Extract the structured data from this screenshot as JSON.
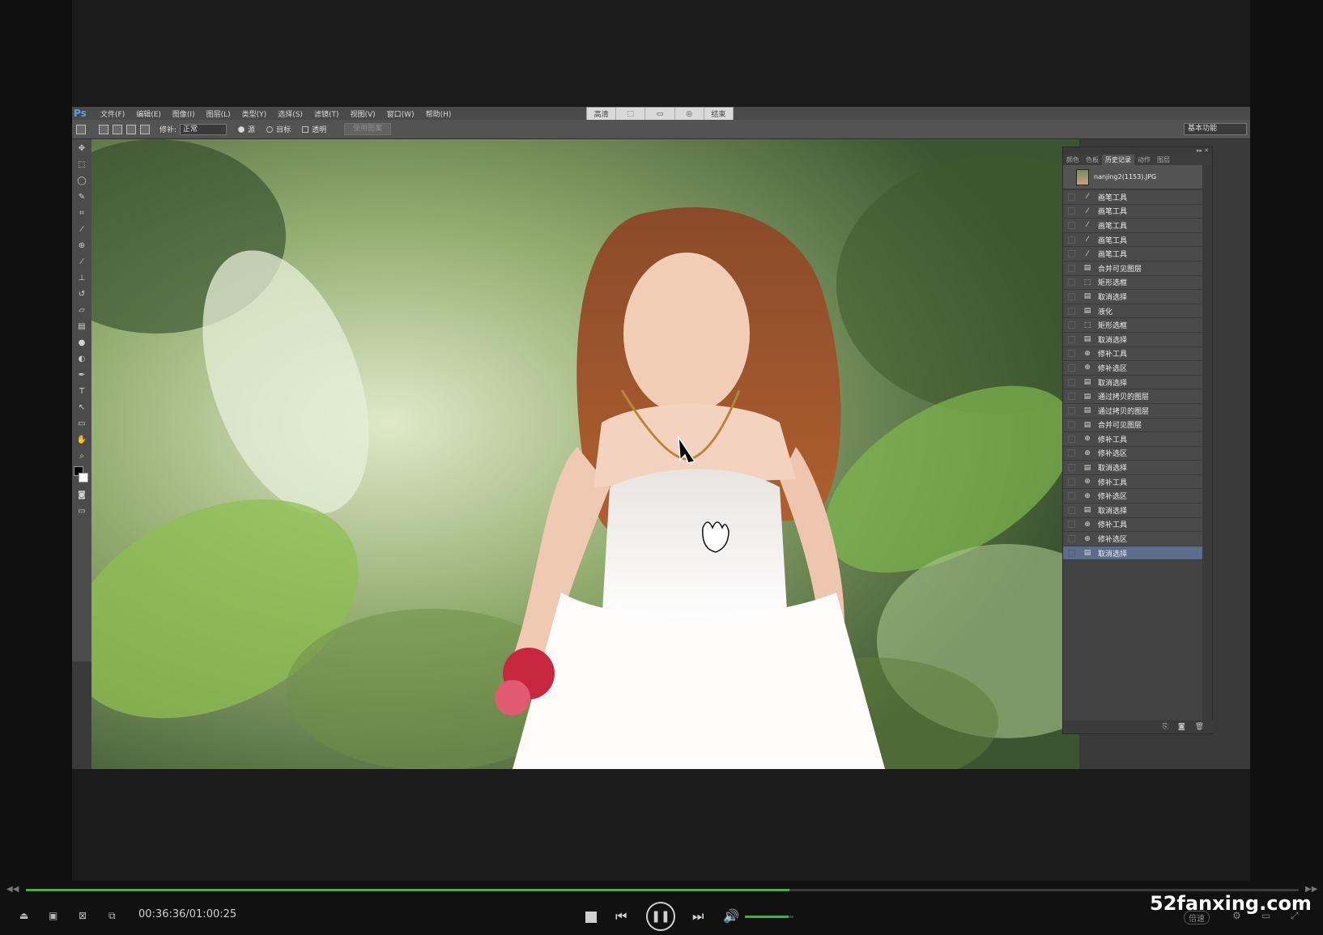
{
  "photoshop": {
    "logo": "Ps",
    "menus": [
      "文件(F)",
      "编辑(E)",
      "图像(I)",
      "图层(L)",
      "类型(Y)",
      "选择(S)",
      "滤镜(T)",
      "视图(V)",
      "窗口(W)",
      "帮助(H)"
    ],
    "view_strip": [
      "高清",
      "⬚",
      "▭",
      "◎",
      "结束"
    ],
    "options_bar": {
      "patch_label": "修补:",
      "patch_mode": "正常",
      "source_label": "源",
      "target_label": "目标",
      "transparent_label": "透明",
      "use_pattern_label": "使用图案",
      "workspace": "基本功能"
    }
  },
  "history_panel": {
    "top_controls": "▸▸ ✕",
    "tabs": [
      "颜色",
      "色板",
      "历史记录",
      "动作",
      "图层"
    ],
    "active_tab": "历史记录",
    "snapshot_name": "nanjing2(1153).JPG",
    "steps": [
      {
        "label": "画笔工具",
        "icon": "brush"
      },
      {
        "label": "画笔工具",
        "icon": "brush"
      },
      {
        "label": "画笔工具",
        "icon": "brush"
      },
      {
        "label": "画笔工具",
        "icon": "brush"
      },
      {
        "label": "画笔工具",
        "icon": "brush"
      },
      {
        "label": "合并可见图层",
        "icon": "layer"
      },
      {
        "label": "矩形选框",
        "icon": "marquee"
      },
      {
        "label": "取消选择",
        "icon": "layer"
      },
      {
        "label": "液化",
        "icon": "layer"
      },
      {
        "label": "矩形选框",
        "icon": "marquee"
      },
      {
        "label": "取消选择",
        "icon": "layer"
      },
      {
        "label": "修补工具",
        "icon": "patch"
      },
      {
        "label": "修补选区",
        "icon": "patch"
      },
      {
        "label": "取消选择",
        "icon": "layer"
      },
      {
        "label": "通过拷贝的图层",
        "icon": "layer"
      },
      {
        "label": "通过拷贝的图层",
        "icon": "layer"
      },
      {
        "label": "合并可见图层",
        "icon": "layer"
      },
      {
        "label": "修补工具",
        "icon": "patch"
      },
      {
        "label": "修补选区",
        "icon": "patch"
      },
      {
        "label": "取消选择",
        "icon": "layer"
      },
      {
        "label": "修补工具",
        "icon": "patch"
      },
      {
        "label": "修补选区",
        "icon": "patch"
      },
      {
        "label": "取消选择",
        "icon": "layer"
      },
      {
        "label": "修补工具",
        "icon": "patch"
      },
      {
        "label": "修补选区",
        "icon": "patch"
      },
      {
        "label": "取消选择",
        "icon": "layer",
        "selected": true
      }
    ],
    "footer_icons": [
      "new-document-from-state-icon",
      "new-snapshot-icon",
      "trash-icon"
    ]
  },
  "player": {
    "timecode": "00:36:36/01:00:25",
    "progress": 0.6,
    "volume": 0.9,
    "speed_label": "倍速",
    "watermark": "52fanxing.com"
  },
  "colors": {
    "accent_green": "#3fb13f",
    "history_selected": "#5b6d8b"
  }
}
